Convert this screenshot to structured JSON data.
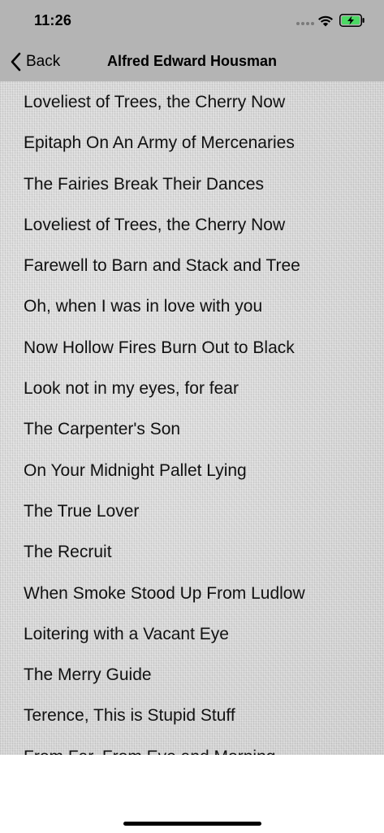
{
  "status_bar": {
    "time": "11:26"
  },
  "nav": {
    "back_label": "Back",
    "title": "Alfred Edward Housman"
  },
  "poems": [
    "Loveliest of Trees, the Cherry Now",
    "Epitaph On An Army of Mercenaries",
    "The Fairies Break Their Dances",
    "Loveliest of Trees, the Cherry Now",
    "Farewell to Barn and Stack and Tree",
    "Oh, when I was in love with you",
    "Now Hollow Fires Burn Out to Black",
    "Look not in my eyes, for fear",
    "The Carpenter's Son",
    "On Your Midnight Pallet Lying",
    "The True Lover",
    "The Recruit",
    "When Smoke Stood Up From Ludlow",
    "Loitering with a Vacant Eye",
    "The Merry Guide",
    "Terence, This is Stupid Stuff",
    "From Far, From Eve and Morning"
  ],
  "colors": {
    "bar_background": "#b4b4b4",
    "battery_fill": "#4cd964"
  },
  "icons": {
    "wifi": "wifi-icon",
    "battery": "battery-charging-icon",
    "back": "chevron-left-icon"
  }
}
